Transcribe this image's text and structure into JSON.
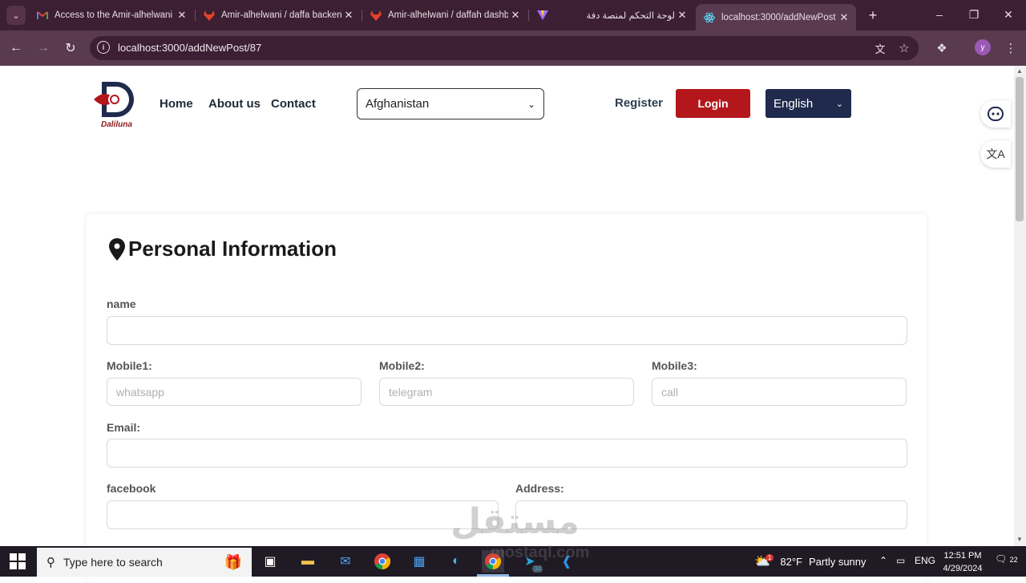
{
  "browser": {
    "tabs": [
      {
        "title": "Access to the Amir-alhelwani",
        "favicon": "gmail-icon"
      },
      {
        "title": "Amir-alhelwani / daffa backend",
        "favicon": "gitlab-icon"
      },
      {
        "title": "Amir-alhelwani / daffah dashboard",
        "favicon": "gitlab-icon"
      },
      {
        "title": "لوحة التحكم لمنصة دفة",
        "favicon": "vite-icon"
      },
      {
        "title": "localhost:3000/addNewPost",
        "favicon": "react-icon",
        "active": true
      }
    ],
    "url": "localhost:3000/addNewPost/87",
    "profile_initial": "y"
  },
  "header": {
    "logo_text": "Daliluna",
    "nav": [
      "Home",
      "About us",
      "Contact"
    ],
    "country": "Afghanistan",
    "register": "Register",
    "login": "Login",
    "language": "English"
  },
  "form": {
    "title": "Personal Information",
    "name_label": "name",
    "mobile1_label": "Mobile1:",
    "mobile1_placeholder": "whatsapp",
    "mobile2_label": "Mobile2:",
    "mobile2_placeholder": "telegram",
    "mobile3_label": "Mobile3:",
    "mobile3_placeholder": "call",
    "email_label": "Email:",
    "facebook_label": "facebook",
    "address_label": "Address:"
  },
  "taskbar": {
    "search_placeholder": "Type here to search",
    "telegram_badge": "34",
    "weather_temp": "82°F",
    "weather_desc": "Partly sunny",
    "weather_badge": "1",
    "lang": "ENG",
    "time": "12:51 PM",
    "date": "4/29/2024",
    "notifications": "22"
  },
  "watermark": {
    "arabic": "مستقل",
    "latin": "mostaql.com"
  },
  "colors": {
    "login": "#b3161b",
    "language": "#1f2a4d",
    "tabbar": "#3d1f33",
    "toolbar": "#5a3a4f"
  }
}
